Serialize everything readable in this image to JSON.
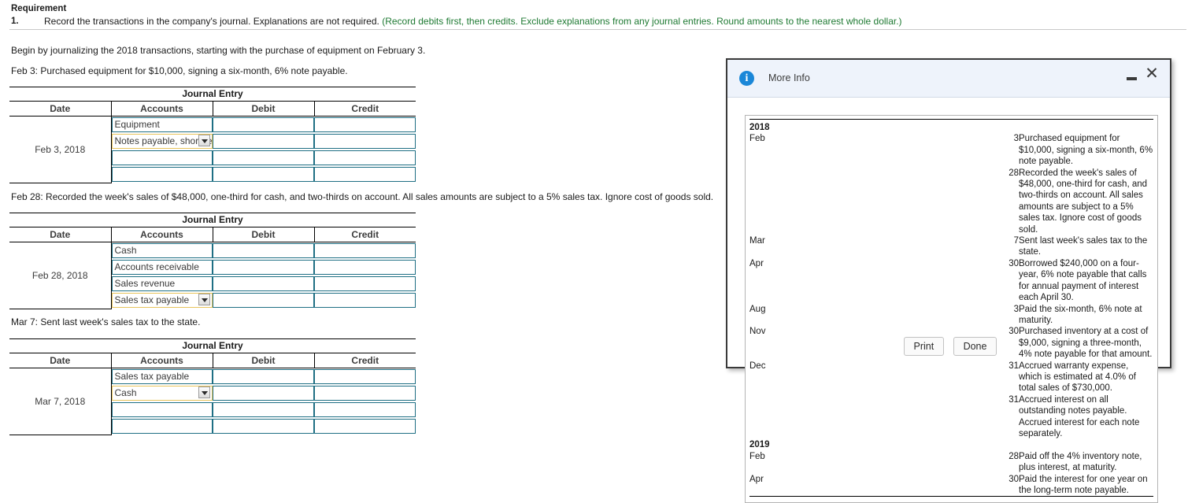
{
  "requirement": {
    "heading": "Requirement",
    "number": "1.",
    "text": "Record the transactions in the company's journal. Explanations are not required. ",
    "hint": "(Record debits first, then credits. Exclude explanations from any journal entries. Round amounts to the nearest whole dollar.)"
  },
  "prompts": {
    "begin": "Begin by journalizing the 2018 transactions, starting with the purchase of equipment on February 3.",
    "feb3": "Feb 3: Purchased equipment for $10,000, signing a six-month, 6% note payable.",
    "feb28": "Feb 28: Recorded the week's sales of $48,000, one-third for cash, and two-thirds on account. All sales amounts are subject to a 5% sales tax. Ignore cost of goods sold.",
    "mar7": "Mar 7: Sent last week's sales tax to the state."
  },
  "journal": {
    "caption": "Journal Entry",
    "columns": {
      "date": "Date",
      "accounts": "Accounts",
      "debit": "Debit",
      "credit": "Credit"
    },
    "entries": [
      {
        "date": "Feb 3, 2018",
        "rows": [
          {
            "account": "Equipment",
            "dropdown": false,
            "debit": "",
            "credit": ""
          },
          {
            "account": "Notes payable, short-term",
            "dropdown": true,
            "debit": "",
            "credit": ""
          },
          {
            "account": "",
            "dropdown": false,
            "debit": "",
            "credit": ""
          },
          {
            "account": "",
            "dropdown": false,
            "debit": "",
            "credit": ""
          }
        ]
      },
      {
        "date": "Feb 28, 2018",
        "rows": [
          {
            "account": "Cash",
            "dropdown": false,
            "debit": "",
            "credit": ""
          },
          {
            "account": "Accounts receivable",
            "dropdown": false,
            "debit": "",
            "credit": ""
          },
          {
            "account": "Sales revenue",
            "dropdown": false,
            "debit": "",
            "credit": ""
          },
          {
            "account": "Sales tax payable",
            "dropdown": true,
            "debit": "",
            "credit": ""
          }
        ]
      },
      {
        "date": "Mar 7, 2018",
        "rows": [
          {
            "account": "Sales tax payable",
            "dropdown": false,
            "debit": "",
            "credit": ""
          },
          {
            "account": "Cash",
            "dropdown": true,
            "debit": "",
            "credit": ""
          },
          {
            "account": "",
            "dropdown": false,
            "debit": "",
            "credit": ""
          },
          {
            "account": "",
            "dropdown": false,
            "debit": "",
            "credit": ""
          }
        ]
      }
    ]
  },
  "dialog": {
    "title": "More Info",
    "info_icon": "info-circle-icon",
    "minimize_icon": "minimize-icon",
    "close_icon": "close-icon",
    "rows": [
      {
        "type": "year",
        "year": "2018"
      },
      {
        "type": "item",
        "month": "Feb",
        "day": "3",
        "desc": "Purchased equipment for $10,000, signing a six-month, 6% note payable."
      },
      {
        "type": "item",
        "month": "",
        "day": "28",
        "desc": "Recorded the week's sales of $48,000, one-third for cash, and two-thirds on account. All sales amounts are subject to a 5% sales tax. Ignore cost of goods sold."
      },
      {
        "type": "item",
        "month": "Mar",
        "day": "7",
        "desc": "Sent last week's sales tax to the state."
      },
      {
        "type": "item",
        "month": "Apr",
        "day": "30",
        "desc": "Borrowed $240,000 on a four-year, 6% note payable that calls for annual payment of interest each April 30."
      },
      {
        "type": "item",
        "month": "Aug",
        "day": "3",
        "desc": "Paid the six-month, 6% note at maturity."
      },
      {
        "type": "item",
        "month": "Nov",
        "day": "30",
        "desc": "Purchased inventory at a cost of $9,000, signing a three-month, 4% note payable for that amount."
      },
      {
        "type": "item",
        "month": "Dec",
        "day": "31",
        "desc": "Accrued warranty expense, which is estimated at 4.0% of total sales of $730,000."
      },
      {
        "type": "item",
        "month": "",
        "day": "31",
        "desc": "Accrued interest on all outstanding notes payable. Accrued interest for each note separately."
      },
      {
        "type": "year",
        "year": "2019"
      },
      {
        "type": "item",
        "month": "Feb",
        "day": "28",
        "desc": "Paid off the 4% inventory note, plus interest, at maturity."
      },
      {
        "type": "item",
        "month": "Apr",
        "day": "30",
        "desc": "Paid the interest for one year on the long-term note payable."
      }
    ],
    "buttons": {
      "print": "Print",
      "done": "Done"
    }
  },
  "colors": {
    "hint_green": "#1f7a33",
    "input_border_teal": "#1f6f84",
    "selected_border_yellow": "#e8c45c",
    "dialog_header_blue": "#eef3fb",
    "info_icon_blue": "#1a87d8"
  }
}
